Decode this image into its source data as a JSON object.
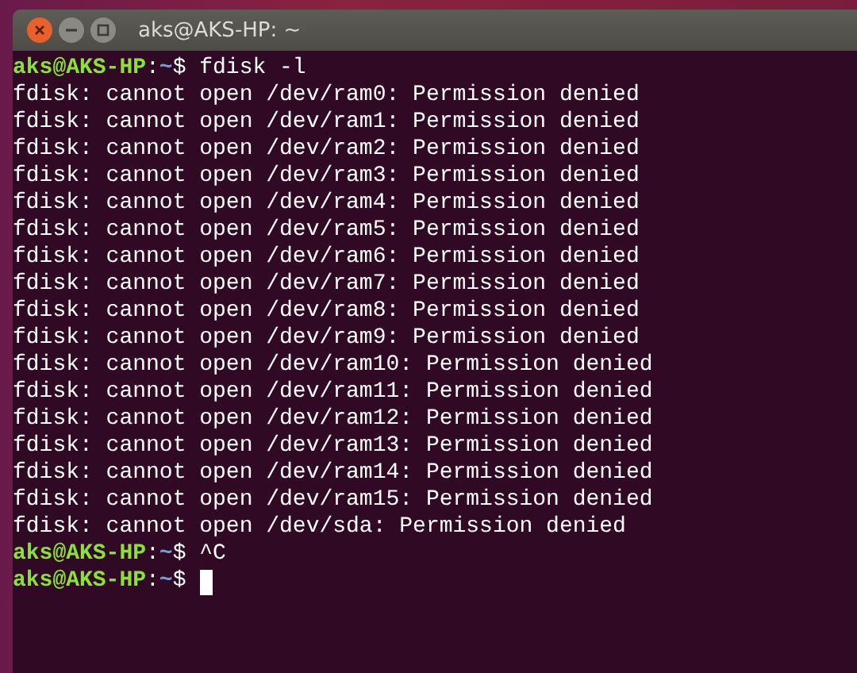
{
  "window": {
    "title": "aks@AKS-HP: ~"
  },
  "terminal": {
    "lines": [
      {
        "kind": "prompt",
        "user": "aks@AKS-HP",
        "separator": ":",
        "path": "~",
        "symbol": "$",
        "command": "fdisk -l",
        "cursor": false
      },
      {
        "kind": "output",
        "text": "fdisk: cannot open /dev/ram0: Permission denied"
      },
      {
        "kind": "output",
        "text": "fdisk: cannot open /dev/ram1: Permission denied"
      },
      {
        "kind": "output",
        "text": "fdisk: cannot open /dev/ram2: Permission denied"
      },
      {
        "kind": "output",
        "text": "fdisk: cannot open /dev/ram3: Permission denied"
      },
      {
        "kind": "output",
        "text": "fdisk: cannot open /dev/ram4: Permission denied"
      },
      {
        "kind": "output",
        "text": "fdisk: cannot open /dev/ram5: Permission denied"
      },
      {
        "kind": "output",
        "text": "fdisk: cannot open /dev/ram6: Permission denied"
      },
      {
        "kind": "output",
        "text": "fdisk: cannot open /dev/ram7: Permission denied"
      },
      {
        "kind": "output",
        "text": "fdisk: cannot open /dev/ram8: Permission denied"
      },
      {
        "kind": "output",
        "text": "fdisk: cannot open /dev/ram9: Permission denied"
      },
      {
        "kind": "output",
        "text": "fdisk: cannot open /dev/ram10: Permission denied"
      },
      {
        "kind": "output",
        "text": "fdisk: cannot open /dev/ram11: Permission denied"
      },
      {
        "kind": "output",
        "text": "fdisk: cannot open /dev/ram12: Permission denied"
      },
      {
        "kind": "output",
        "text": "fdisk: cannot open /dev/ram13: Permission denied"
      },
      {
        "kind": "output",
        "text": "fdisk: cannot open /dev/ram14: Permission denied"
      },
      {
        "kind": "output",
        "text": "fdisk: cannot open /dev/ram15: Permission denied"
      },
      {
        "kind": "output",
        "text": "fdisk: cannot open /dev/sda: Permission denied"
      },
      {
        "kind": "prompt",
        "user": "aks@AKS-HP",
        "separator": ":",
        "path": "~",
        "symbol": "$",
        "command": "^C",
        "cursor": false
      },
      {
        "kind": "prompt",
        "user": "aks@AKS-HP",
        "separator": ":",
        "path": "~",
        "symbol": "$",
        "cursor": true
      }
    ]
  }
}
